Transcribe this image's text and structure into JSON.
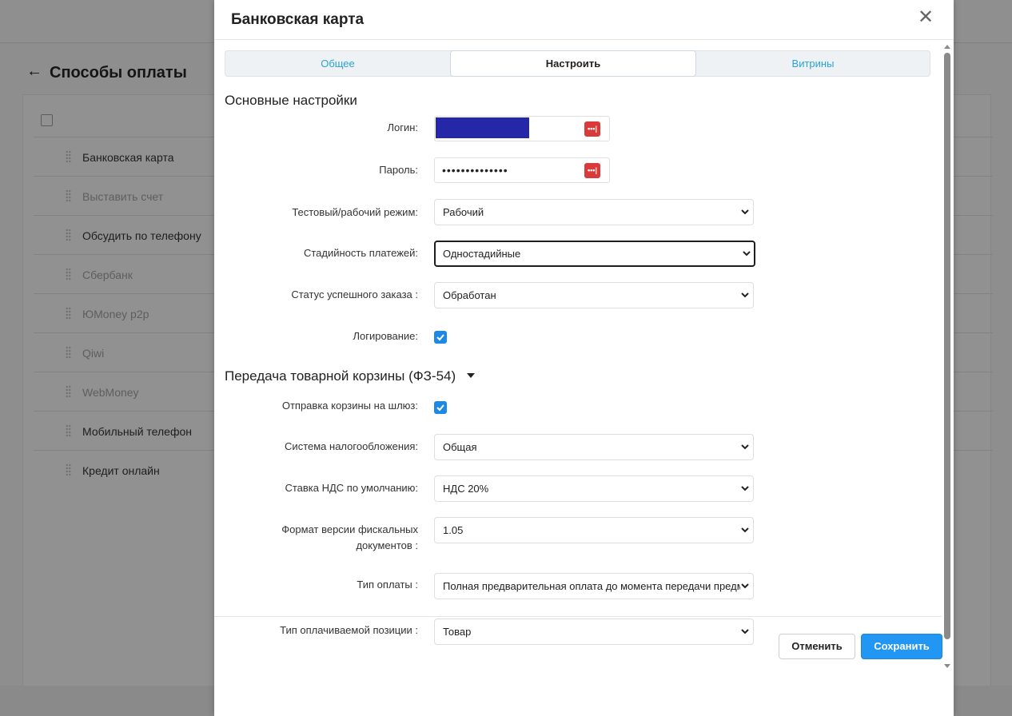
{
  "background": {
    "back_arrow": "←",
    "title": "Способы оплаты",
    "rows": [
      {
        "label": "Банковская карта",
        "active": true
      },
      {
        "label": "Выставить счет",
        "active": false
      },
      {
        "label": "Обсудить по телефону",
        "active": true
      },
      {
        "label": "Сбербанк",
        "active": false
      },
      {
        "label": "ЮMoney p2p",
        "active": false
      },
      {
        "label": "Qiwi",
        "active": false
      },
      {
        "label": "WebMoney",
        "active": false
      },
      {
        "label": "Мобильный телефон",
        "active": true
      },
      {
        "label": "Кредит онлайн",
        "active": true
      }
    ]
  },
  "modal": {
    "title": "Банковская карта",
    "close_icon": "close-icon",
    "tabs": [
      {
        "label": "Общее",
        "active": false
      },
      {
        "label": "Настроить",
        "active": true
      },
      {
        "label": "Витрины",
        "active": false
      }
    ],
    "section_main": "Основные настройки",
    "login_label": "Логин:",
    "password_label": "Пароль:",
    "password_value": "••••••••••••••",
    "mode_label": "Тестовый/рабочий режим:",
    "mode_value": "Рабочий",
    "stages_label": "Стадийность платежей:",
    "stages_value": "Одностадийные",
    "status_label": "Статус успешного заказа :",
    "status_value": "Обработан",
    "logging_label": "Логирование:",
    "logging_checked": true,
    "section_basket": "Передача товарной корзины (ФЗ-54)",
    "send_basket_label": "Отправка корзины на шлюз:",
    "send_basket_checked": true,
    "tax_label": "Система налогообложения:",
    "tax_value": "Общая",
    "vat_label": "Ставка НДС по умолчанию:",
    "vat_value": "НДС 20%",
    "ffd_label_line1": "Формат версии фискальных",
    "ffd_label_line2": "документов :",
    "ffd_value": "1.05",
    "payment_type_label": "Тип оплаты :",
    "payment_type_value": "Полная предварительная оплата до момента передачи предмета расчёта",
    "item_type_label": "Тип оплачиваемой позиции :",
    "item_type_value": "Товар",
    "cancel_label": "Отменить",
    "save_label": "Сохранить",
    "colors": {
      "accent": "#2196f3",
      "tab_text": "#2aa3d6",
      "password_manager": "#d93a3a",
      "redaction": "#2327a8"
    }
  }
}
